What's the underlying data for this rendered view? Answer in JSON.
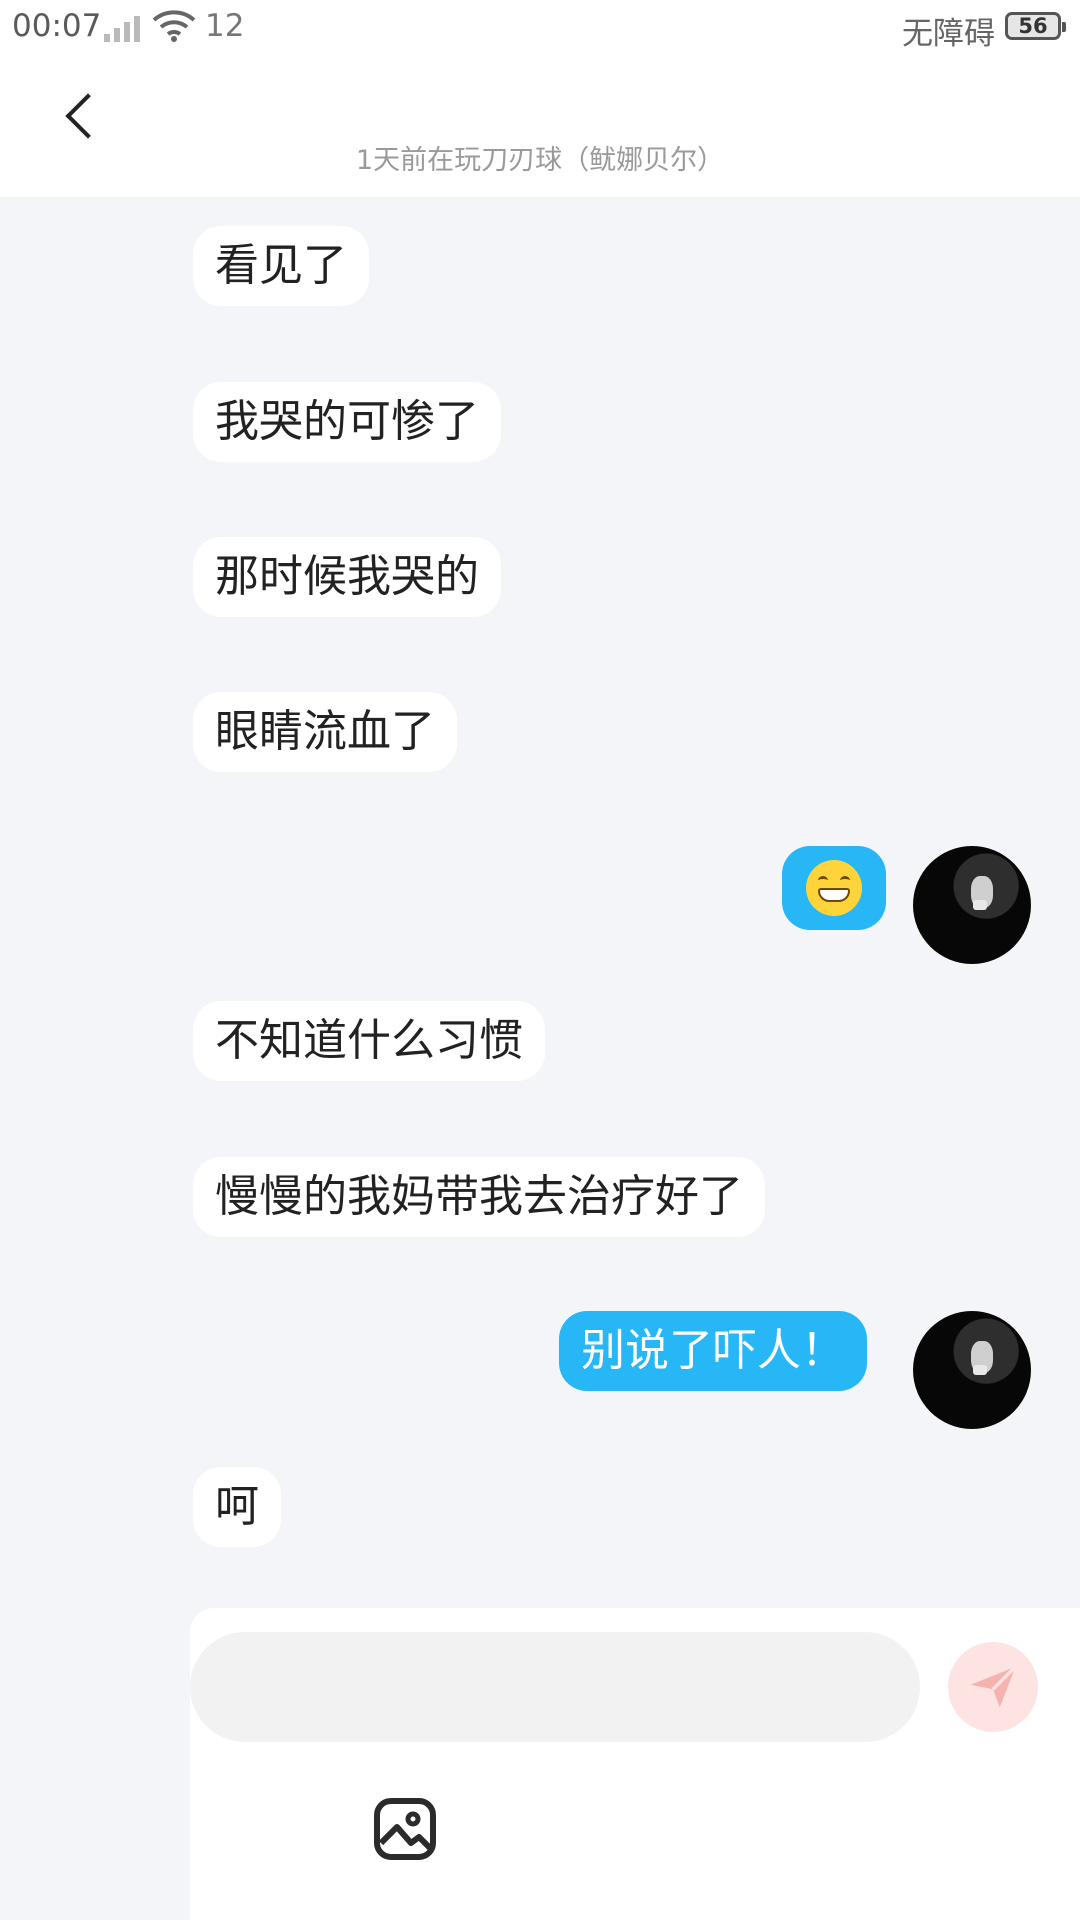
{
  "status_bar": {
    "time": "00:07",
    "extra": "12",
    "right_text": "无障碍",
    "battery": "56",
    "icons": [
      "signal-no-service-icon",
      "wifi-icon"
    ]
  },
  "header": {
    "title": "",
    "subtitle": "1天前在玩刀刃球（鱿娜贝尔）",
    "back_icon": "chevron-left-icon"
  },
  "messages": [
    {
      "side": "in",
      "text": "看见了"
    },
    {
      "side": "in",
      "text": "我哭的可惨了"
    },
    {
      "side": "in",
      "text": "那时候我哭的"
    },
    {
      "side": "in",
      "text": "眼睛流血了"
    },
    {
      "side": "out",
      "type": "emoji",
      "emoji": "grinning-face-emoji"
    },
    {
      "side": "in",
      "text": "不知道什么习惯"
    },
    {
      "side": "in",
      "text": "慢慢的我妈带我去治疗好了"
    },
    {
      "side": "out",
      "text": "别说了吓人！"
    },
    {
      "side": "in",
      "text": "呵"
    }
  ],
  "composer": {
    "input_value": "",
    "placeholder": "",
    "send_icon": "send-icon",
    "image_icon": "image-icon"
  },
  "colors": {
    "outgoing_bubble": "#27b7f7",
    "incoming_bubble": "#ffffff",
    "chat_background": "#f3f5f8",
    "send_button_disabled": "#fde4e2"
  }
}
